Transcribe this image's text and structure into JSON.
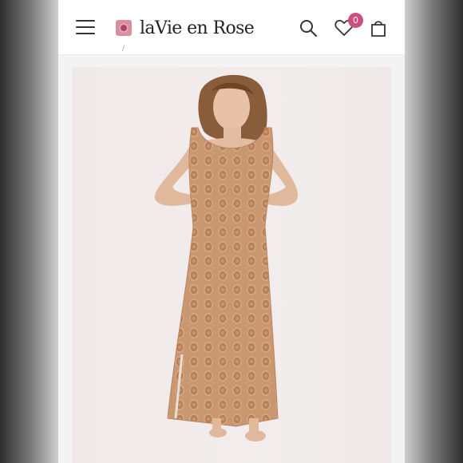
{
  "header": {
    "brand_name": "laVie en Rose",
    "wishlist_count": "0",
    "breadcrumb_fragment": "/"
  },
  "icons": {
    "menu": "hamburger-menu-icon",
    "brand": "rose-logo-icon",
    "search": "search-icon",
    "wishlist": "heart-icon",
    "bag": "shopping-bag-icon"
  },
  "colors": {
    "badge": "#cc4f80",
    "dress": "#c99770",
    "background": "#f3f3f3"
  }
}
